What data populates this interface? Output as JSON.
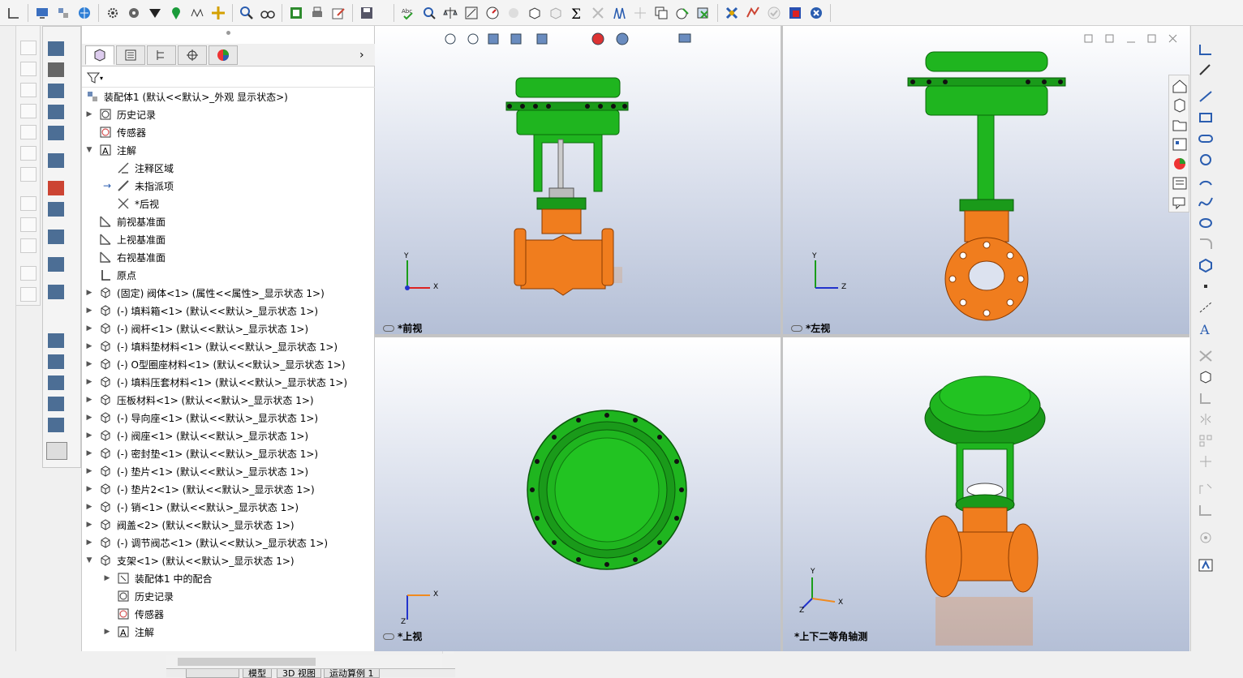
{
  "toolbar": {
    "icons": [
      "shaded-icon",
      "sketch-icon",
      "display-icon",
      "assembly-icon",
      "globe-icon",
      "gear-icon",
      "settings-icon",
      "tone-icon",
      "map-pin-icon",
      "wireframe-icon",
      "move-icon",
      "zoom-icon",
      "binoculars-icon",
      "export-icon",
      "print-icon",
      "edit-icon",
      "save-icon",
      "spellcheck-icon",
      "measure-icon",
      "mass-properties-icon",
      "section-icon",
      "performance-icon",
      "hidden-icon",
      "box-icon",
      "sum-icon",
      "interference-icon",
      "hole-icon",
      "sparkle-icon",
      "copy-icon",
      "check-icon",
      "delete-icon",
      "toolbox-icon",
      "simulation-icon",
      "approved-icon",
      "flag-icon",
      "compass-icon"
    ]
  },
  "tree": {
    "root": "装配体1  (默认<<默认>_外观 显示状态>)",
    "items": [
      {
        "label": "历史记录",
        "indent": 1,
        "arrow": "▶",
        "icon": "history-icon"
      },
      {
        "label": "传感器",
        "indent": 1,
        "arrow": "",
        "icon": "sensor-icon"
      },
      {
        "label": "注解",
        "indent": 1,
        "arrow": "▼",
        "icon": "annotation-icon"
      },
      {
        "label": "注释区域",
        "indent": 2,
        "arrow": "",
        "icon": "note-area-icon"
      },
      {
        "label": "未指派项",
        "indent": 2,
        "arrow": "→",
        "icon": "unassigned-icon"
      },
      {
        "label": "*后视",
        "indent": 2,
        "arrow": "",
        "icon": "view-icon"
      },
      {
        "label": "前视基准面",
        "indent": 1,
        "arrow": "",
        "icon": "plane-icon"
      },
      {
        "label": "上视基准面",
        "indent": 1,
        "arrow": "",
        "icon": "plane-icon"
      },
      {
        "label": "右视基准面",
        "indent": 1,
        "arrow": "",
        "icon": "plane-icon"
      },
      {
        "label": "原点",
        "indent": 1,
        "arrow": "",
        "icon": "origin-icon"
      },
      {
        "label": "(固定) 阀体<1> (属性<<属性>_显示状态 1>)",
        "indent": 1,
        "arrow": "▶",
        "icon": "part-icon"
      },
      {
        "label": "(-) 填料箱<1> (默认<<默认>_显示状态 1>)",
        "indent": 1,
        "arrow": "▶",
        "icon": "part-icon"
      },
      {
        "label": "(-) 阀杆<1> (默认<<默认>_显示状态 1>)",
        "indent": 1,
        "arrow": "▶",
        "icon": "part-icon"
      },
      {
        "label": "(-) 填料垫材料<1> (默认<<默认>_显示状态 1>)",
        "indent": 1,
        "arrow": "▶",
        "icon": "part-icon"
      },
      {
        "label": "(-) O型圈座材料<1> (默认<<默认>_显示状态 1>)",
        "indent": 1,
        "arrow": "▶",
        "icon": "part-icon"
      },
      {
        "label": "(-) 填料压套材料<1> (默认<<默认>_显示状态 1>)",
        "indent": 1,
        "arrow": "▶",
        "icon": "part-icon"
      },
      {
        "label": "压板材料<1> (默认<<默认>_显示状态 1>)",
        "indent": 1,
        "arrow": "▶",
        "icon": "part-icon"
      },
      {
        "label": "(-) 导向座<1> (默认<<默认>_显示状态 1>)",
        "indent": 1,
        "arrow": "▶",
        "icon": "part-icon"
      },
      {
        "label": "(-) 阀座<1> (默认<<默认>_显示状态 1>)",
        "indent": 1,
        "arrow": "▶",
        "icon": "part-icon"
      },
      {
        "label": "(-) 密封垫<1> (默认<<默认>_显示状态 1>)",
        "indent": 1,
        "arrow": "▶",
        "icon": "part-icon"
      },
      {
        "label": "(-) 垫片<1> (默认<<默认>_显示状态 1>)",
        "indent": 1,
        "arrow": "▶",
        "icon": "part-icon"
      },
      {
        "label": "(-) 垫片2<1> (默认<<默认>_显示状态 1>)",
        "indent": 1,
        "arrow": "▶",
        "icon": "part-icon"
      },
      {
        "label": "(-) 销<1> (默认<<默认>_显示状态 1>)",
        "indent": 1,
        "arrow": "▶",
        "icon": "part-icon"
      },
      {
        "label": "阀盖<2> (默认<<默认>_显示状态 1>)",
        "indent": 1,
        "arrow": "▶",
        "icon": "part-icon"
      },
      {
        "label": "(-) 调节阀芯<1> (默认<<默认>_显示状态 1>)",
        "indent": 1,
        "arrow": "▶",
        "icon": "part-icon"
      },
      {
        "label": "支架<1> (默认<<默认>_显示状态 1>)",
        "indent": 1,
        "arrow": "▼",
        "icon": "part-icon"
      },
      {
        "label": "装配体1 中的配合",
        "indent": 2,
        "arrow": "▶",
        "icon": "mates-icon"
      },
      {
        "label": "历史记录",
        "indent": 2,
        "arrow": "",
        "icon": "history-icon"
      },
      {
        "label": "传感器",
        "indent": 2,
        "arrow": "",
        "icon": "sensor-icon"
      },
      {
        "label": "注解",
        "indent": 2,
        "arrow": "▶",
        "icon": "annotation-icon"
      }
    ]
  },
  "bottom_tabs": [
    "模型",
    "3D 视图",
    "运动算例 1"
  ],
  "viewports": {
    "front": {
      "label": "*前视",
      "axis_x": "X",
      "axis_y": "Y"
    },
    "left": {
      "label": "*左视",
      "axis_y": "Y",
      "axis_z": "Z"
    },
    "top": {
      "label": "*上视",
      "axis_x": "X",
      "axis_z": "Z"
    },
    "iso": {
      "label": "*上下二等角轴测",
      "axis_x": "X",
      "axis_y": "Y",
      "axis_z": "Z"
    }
  },
  "colors": {
    "valve_green": "#1fb51f",
    "valve_orange": "#f07d1e",
    "bg_top": "#ffffff",
    "bg_bottom": "#b4bfd6"
  }
}
